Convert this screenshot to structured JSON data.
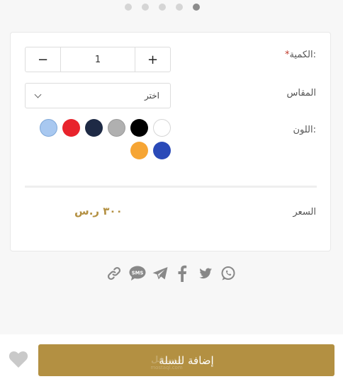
{
  "carousel": {
    "dot_count": 5,
    "active_index": 4
  },
  "options": {
    "quantity_label": "الكمية:",
    "quantity_required_mark": "*",
    "quantity_value": "1",
    "minus_label": "−",
    "plus_label": "+",
    "size_label": "المقاس",
    "size_selected": "اختر",
    "color_label": "اللون:",
    "colors": [
      "#ffffff",
      "#000000",
      "#b0b0b0",
      "#1e2a45",
      "#e8232c",
      "#a8c8f0",
      "#2a4ab8",
      "#f6a534"
    ]
  },
  "price": {
    "label": "السعر",
    "value": "٣٠٠ ر.س"
  },
  "share": {
    "icons": [
      "whatsapp-icon",
      "twitter-icon",
      "facebook-icon",
      "telegram-icon",
      "sms-icon",
      "link-icon"
    ]
  },
  "actions": {
    "add_to_cart_label": "إضافة للسلة",
    "wishlist_icon": "heart-icon"
  },
  "watermark": {
    "arabic": "مستقل",
    "latin": "mostaql.com"
  },
  "theme": {
    "accent": "#b39042",
    "required_color": "#c0392b",
    "icon_color": "#888888"
  }
}
